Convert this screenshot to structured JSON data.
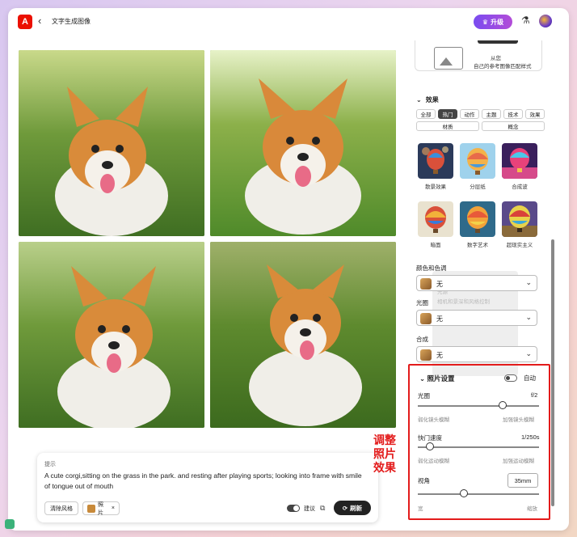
{
  "header": {
    "logo": "A",
    "title": "文字生成图像",
    "upgrade_label": "升级",
    "upgrade_icon": "crown-icon",
    "flask_icon": "flask-icon",
    "avatar": "avatar"
  },
  "prompt": {
    "label": "提示",
    "text": "A cute corgi,sitting on the grass in the park. and resting after playing sports; looking into frame with smile of tongue out of mouth",
    "clear_style": "清除风格",
    "photo_chip": "照片",
    "suggest": "建议",
    "refresh": "刷新"
  },
  "annotation": "调整照片效果",
  "panel": {
    "ref_text1": "从您",
    "ref_text2": "自己的参考图像匹配样式",
    "effects_title": "效果",
    "tags_row1": [
      "全部",
      "热门",
      "动作",
      "主题",
      "技术",
      "效果"
    ],
    "tags_row2": [
      "材质",
      "概念"
    ],
    "active_tag": "热门",
    "effects": [
      {
        "label": "散景效果"
      },
      {
        "label": "分层纸"
      },
      {
        "label": "合成波"
      },
      {
        "label": "暗面"
      },
      {
        "label": "数字艺术"
      },
      {
        "label": "超现实主义"
      }
    ],
    "color_tone_label": "颜色和色调",
    "color_tone_value": "无",
    "lighting_label": "光圈",
    "lighting_value": "无",
    "composition_label": "合成",
    "composition_value": "无",
    "ghost_text1": "光源",
    "ghost_text2": "相机和景深和风格控制",
    "photo_settings": {
      "title": "照片设置",
      "auto_label": "自动",
      "aperture_label": "光圈",
      "aperture_value": "f/2",
      "aperture_level": 0.7,
      "aperture_hint_left": "弱化镜头模糊",
      "aperture_hint_right": "加强镜头模糊",
      "shutter_label": "快门速度",
      "shutter_value": "1/250s",
      "shutter_level": 0.1,
      "shutter_hint_left": "弱化运动模糊",
      "shutter_hint_right": "加强运动模糊",
      "fov_label": "视角",
      "fov_value": "35mm",
      "fov_level": 0.38,
      "fov_hint_left": "宽",
      "fov_hint_right": "缩放"
    }
  },
  "colors": {
    "accent_red": "#e31b1b",
    "upgrade_gradient": [
      "#7a4cf0",
      "#b34cd8"
    ],
    "adobe_red": "#eb1000"
  }
}
